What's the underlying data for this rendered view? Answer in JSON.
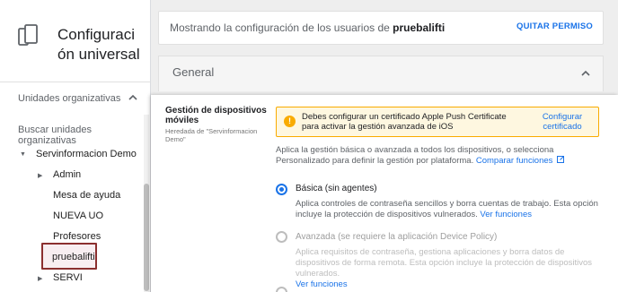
{
  "app": {
    "title": "Configuración universal",
    "title_line1": "Configuraci",
    "title_line2": "ón universal"
  },
  "org_units": {
    "title": "Unidades organizativas",
    "search_placeholder": "Buscar unidades organizativas",
    "tree": [
      {
        "label": "Servinformacion Demo",
        "level": 0,
        "expanded": true
      },
      {
        "label": "Admin",
        "level": 1,
        "expandable": true
      },
      {
        "label": "Mesa de ayuda",
        "level": 1
      },
      {
        "label": "NUEVA UO",
        "level": 1
      },
      {
        "label": "Profesores",
        "level": 1
      },
      {
        "label": "pruebalifti",
        "level": 1,
        "selected": true
      },
      {
        "label": "SERVI",
        "level": 1,
        "expandable": true
      }
    ]
  },
  "info_bar": {
    "prefix": "Mostrando la configuración de los usuarios de ",
    "ou_name": "pruebalifti",
    "quit_label": "QUITAR PERMISO"
  },
  "general": {
    "title": "General"
  },
  "setting": {
    "name": "Gestión de dispositivos móviles",
    "inherited": "Heredada de \"Servinformacion Demo\"",
    "warning": {
      "text": "Debes configurar un certificado Apple Push Certificate para activar la gestión avanzada de iOS",
      "link": "Configurar certificado"
    },
    "description": "Aplica la gestión básica o avanzada a todos los dispositivos, o selecciona Personalizado para definir la gestión por plataforma.",
    "compare_link": "Comparar funciones",
    "options": [
      {
        "label": "Básica (sin agentes)",
        "checked": true,
        "description": "Aplica controles de contraseña sencillos y borra cuentas de trabajo. Esta opción incluye la protección de dispositivos vulnerados.",
        "link": "Ver funciones"
      },
      {
        "label": "Avanzada (se requiere la aplicación Device Policy)",
        "checked": false,
        "description": "Aplica requisitos de contraseña, gestiona aplicaciones y borra datos de dispositivos de forma remota. Esta opción incluye la protección de dispositivos vulnerados.",
        "link": "Ver funciones"
      }
    ]
  },
  "colors": {
    "accent": "#1a73e8",
    "warning_border": "#f9ab00",
    "warning_bg": "#fef7e0",
    "selected_border": "#8b2f2f"
  }
}
